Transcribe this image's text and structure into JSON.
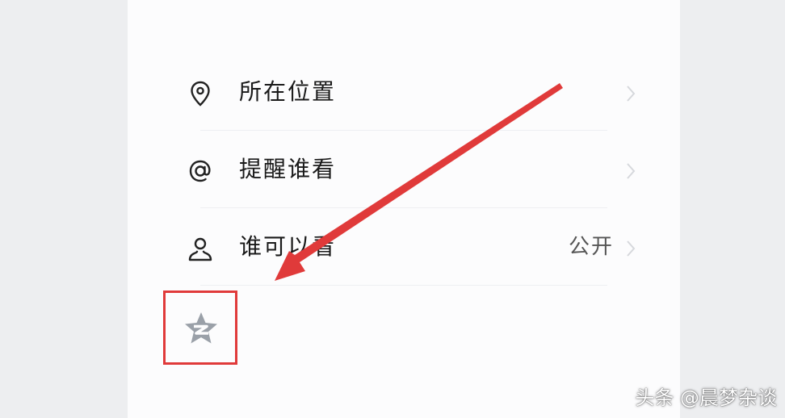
{
  "settings_list": {
    "items": [
      {
        "label": "所在位置",
        "icon": "location-pin-icon",
        "value": ""
      },
      {
        "label": "提醒谁看",
        "icon": "at-sign-icon",
        "value": ""
      },
      {
        "label": "谁可以看",
        "icon": "person-icon",
        "value": "公开"
      }
    ]
  },
  "highlighted_icon": {
    "icon": "qzone-star-icon",
    "color": "#9aa0a8"
  },
  "annotation": {
    "arrow_color": "#e03a3a",
    "box_color": "#e03a3a"
  },
  "watermark": {
    "text": "头条 @晨梦杂谈"
  }
}
